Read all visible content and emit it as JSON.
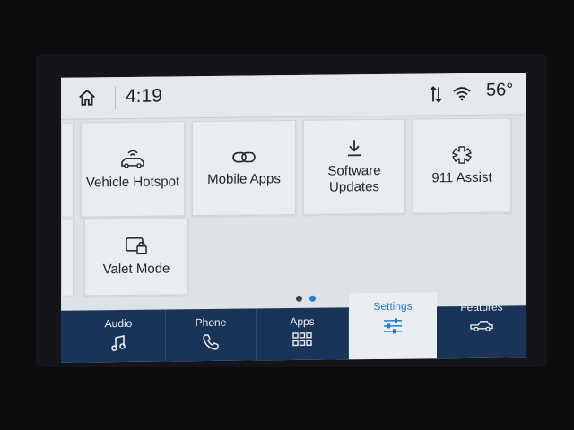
{
  "status_bar": {
    "time": "4:19",
    "temperature": "56°",
    "icons": [
      "home-icon",
      "data-transfer-icon",
      "wifi-icon"
    ]
  },
  "settings_tiles": [
    {
      "label": "Vehicle Hotspot",
      "icon": "vehicle-hotspot-icon"
    },
    {
      "label": "Mobile Apps",
      "icon": "link-icon"
    },
    {
      "label": "Software\nUpdates",
      "icon": "download-icon"
    },
    {
      "label": "911 Assist",
      "icon": "emergency-assist-icon"
    },
    {
      "label": "Valet Mode",
      "icon": "valet-lock-icon"
    }
  ],
  "pagination": {
    "pages": 2,
    "active_page": 2
  },
  "bottom_nav": [
    {
      "label": "Audio",
      "icon": "music-note-icon",
      "active": false
    },
    {
      "label": "Phone",
      "icon": "phone-icon",
      "active": false
    },
    {
      "label": "Apps",
      "icon": "apps-grid-icon",
      "active": false
    },
    {
      "label": "Settings",
      "icon": "sliders-icon",
      "active": true
    },
    {
      "label": "Features",
      "icon": "truck-icon",
      "active": false
    }
  ],
  "colors": {
    "screen_bg": "#dde2e7",
    "nav_bg": "#1a3358",
    "accent": "#2a7bc1",
    "text": "#20262b"
  }
}
